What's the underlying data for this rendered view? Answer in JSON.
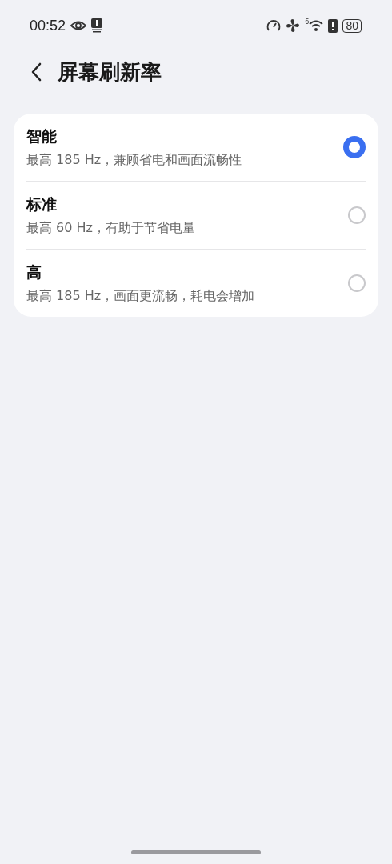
{
  "status_bar": {
    "time": "00:52",
    "wifi_badge": "6",
    "battery": "80"
  },
  "header": {
    "title": "屏幕刷新率"
  },
  "options": [
    {
      "title": "智能",
      "subtitle": "最高 185 Hz，兼顾省电和画面流畅性",
      "selected": true
    },
    {
      "title": "标准",
      "subtitle": "最高 60 Hz，有助于节省电量",
      "selected": false
    },
    {
      "title": "高",
      "subtitle": "最高 185 Hz，画面更流畅，耗电会增加",
      "selected": false
    }
  ]
}
